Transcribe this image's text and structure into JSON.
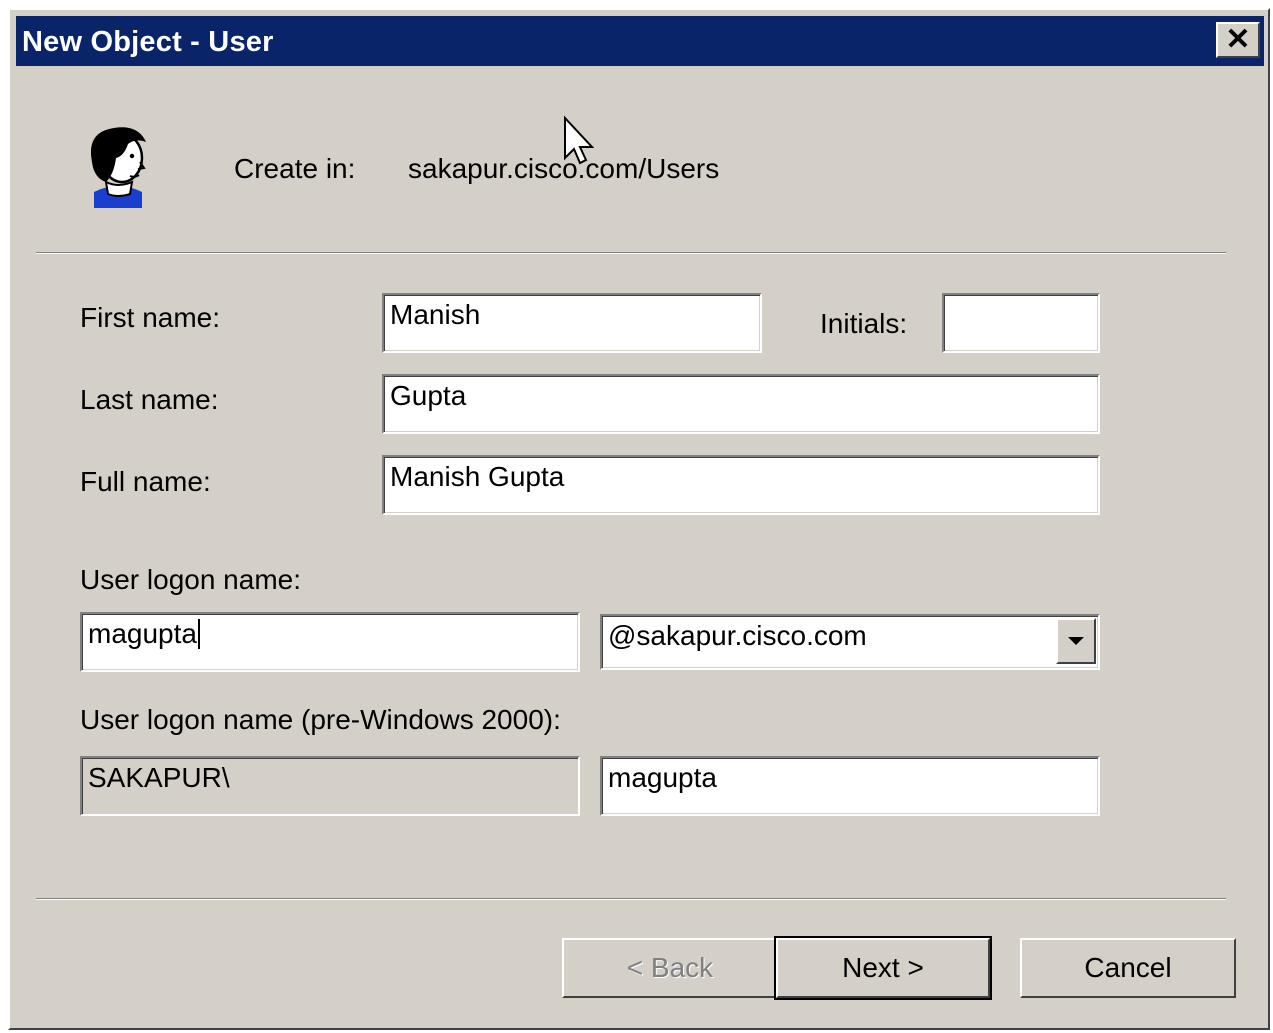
{
  "window": {
    "title": "New Object - User",
    "close_glyph": "✕"
  },
  "header": {
    "icon": "user-icon",
    "create_in_label": "Create in:",
    "create_in_path": "sakapur.cisco.com/Users"
  },
  "form": {
    "first_name": {
      "label": "First name:",
      "value": "Manish"
    },
    "initials": {
      "label": "Initials:",
      "value": ""
    },
    "last_name": {
      "label": "Last name:",
      "value": "Gupta"
    },
    "full_name": {
      "label": "Full name:",
      "value": "Manish Gupta"
    },
    "logon_name": {
      "label": "User logon name:",
      "value": "magupta",
      "domain_selected": "@sakapur.cisco.com"
    },
    "pre2000": {
      "label": "User logon name (pre-Windows 2000):",
      "domain_prefix": "SAKAPUR\\",
      "value": "magupta"
    }
  },
  "buttons": {
    "back": "< Back",
    "next": "Next >",
    "cancel": "Cancel"
  },
  "colors": {
    "titlebar": "#0a246a",
    "dialog_bg": "#d4d0c8",
    "avatar_shirt": "#1a3fcf"
  }
}
